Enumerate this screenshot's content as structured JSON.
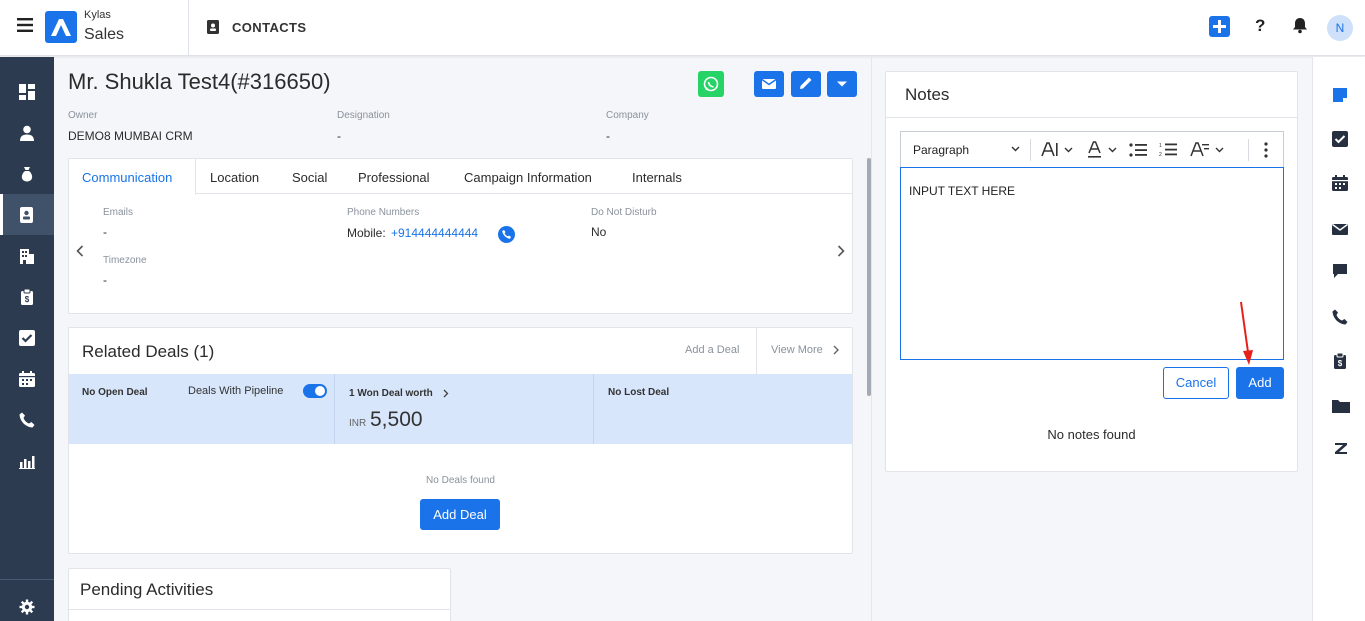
{
  "brand": {
    "top": "Kylas",
    "name": "Sales"
  },
  "header": {
    "module": "CONTACTS",
    "avatar_initial": "N"
  },
  "contact": {
    "title": "Mr. Shukla Test4(#316650)",
    "owner_label": "Owner",
    "owner": "DEMO8 MUMBAI CRM",
    "designation_label": "Designation",
    "designation": "-",
    "company_label": "Company",
    "company": "-"
  },
  "tabs": [
    "Communication",
    "Location",
    "Social",
    "Professional",
    "Campaign Information",
    "Internals"
  ],
  "communication": {
    "emails_label": "Emails",
    "emails": "-",
    "phones_label": "Phone Numbers",
    "mobile_label": "Mobile:",
    "mobile": "+914444444444",
    "dnd_label": "Do Not Disturb",
    "dnd": "No",
    "timezone_label": "Timezone",
    "timezone": "-"
  },
  "deals": {
    "title": "Related Deals (1)",
    "add_link": "Add a Deal",
    "view_more": "View More",
    "open": "No Open Deal",
    "pipeline_toggle": "Deals With Pipeline",
    "won_label": "1 Won Deal worth",
    "won_currency": "INR",
    "won_amount": "5,500",
    "lost": "No Lost Deal",
    "empty": "No Deals found",
    "add_button": "Add Deal"
  },
  "activities": {
    "title": "Pending Activities"
  },
  "notes": {
    "title": "Notes",
    "format_select": "Paragraph",
    "editor_text": "INPUT TEXT HERE",
    "cancel": "Cancel",
    "add": "Add",
    "empty": "No notes found"
  },
  "colors": {
    "accent": "#1a73e8",
    "nav_bg": "#2c3b4f",
    "whatsapp": "#25d366",
    "arrow": "#e8201a"
  }
}
